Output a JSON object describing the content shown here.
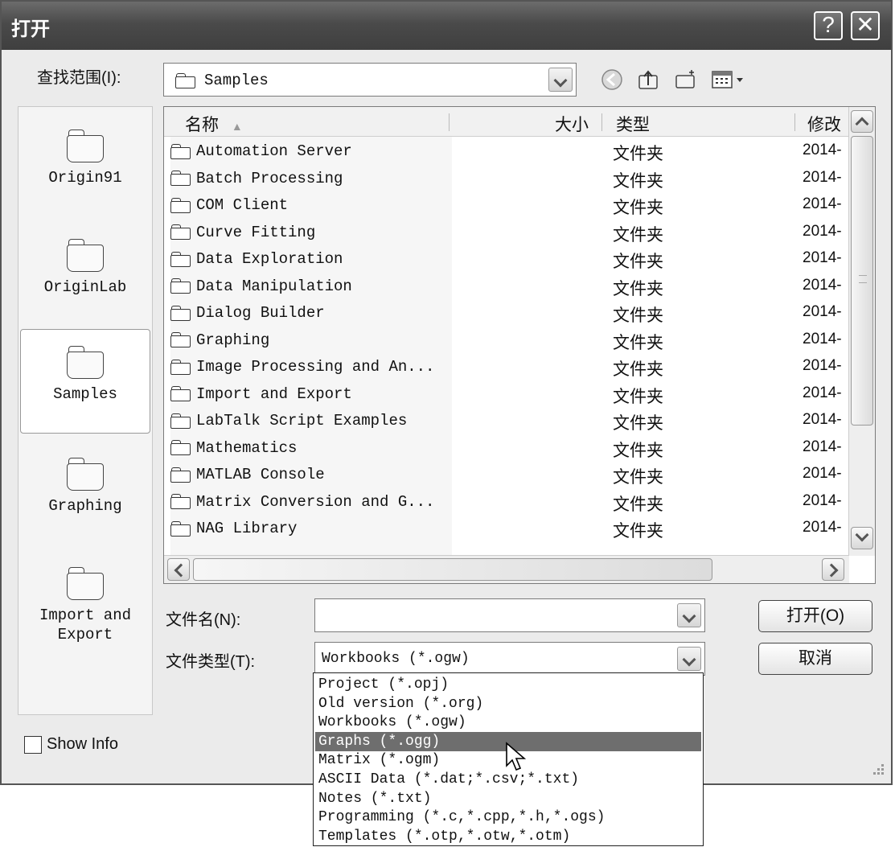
{
  "window": {
    "title": "打开",
    "help_label": "?",
    "close_label": "✕"
  },
  "lookin": {
    "label": "查找范围(I):",
    "value": "Samples"
  },
  "toolbar": {
    "back": "back-icon",
    "up": "up-folder-icon",
    "newfolder": "new-folder-icon",
    "views": "views-icon"
  },
  "places": [
    {
      "label": "Origin91"
    },
    {
      "label": "OriginLab"
    },
    {
      "label": "Samples"
    },
    {
      "label": "Graphing"
    },
    {
      "label": "Import and\nExport"
    }
  ],
  "columns": {
    "name": "名称",
    "size": "大小",
    "type": "类型",
    "modified": "修改"
  },
  "files": [
    {
      "name": "Automation Server",
      "type": "文件夹",
      "modified": "2014-"
    },
    {
      "name": "Batch Processing",
      "type": "文件夹",
      "modified": "2014-"
    },
    {
      "name": "COM Client",
      "type": "文件夹",
      "modified": "2014-"
    },
    {
      "name": "Curve Fitting",
      "type": "文件夹",
      "modified": "2014-"
    },
    {
      "name": "Data Exploration",
      "type": "文件夹",
      "modified": "2014-"
    },
    {
      "name": "Data Manipulation",
      "type": "文件夹",
      "modified": "2014-"
    },
    {
      "name": "Dialog Builder",
      "type": "文件夹",
      "modified": "2014-"
    },
    {
      "name": "Graphing",
      "type": "文件夹",
      "modified": "2014-"
    },
    {
      "name": "Image Processing and An...",
      "type": "文件夹",
      "modified": "2014-"
    },
    {
      "name": "Import and Export",
      "type": "文件夹",
      "modified": "2014-"
    },
    {
      "name": "LabTalk Script Examples",
      "type": "文件夹",
      "modified": "2014-"
    },
    {
      "name": "Mathematics",
      "type": "文件夹",
      "modified": "2014-"
    },
    {
      "name": "MATLAB Console",
      "type": "文件夹",
      "modified": "2014-"
    },
    {
      "name": "Matrix Conversion and G...",
      "type": "文件夹",
      "modified": "2014-"
    },
    {
      "name": "NAG Library",
      "type": "文件夹",
      "modified": "2014-"
    }
  ],
  "filename": {
    "label": "文件名(N):",
    "value": ""
  },
  "filetype": {
    "label": "文件类型(T):",
    "value": "Workbooks (*.ogw)",
    "options": [
      "Project (*.opj)",
      "Old version (*.org)",
      "Workbooks (*.ogw)",
      "Graphs (*.ogg)",
      "Matrix (*.ogm)",
      "ASCII Data (*.dat;*.csv;*.txt)",
      "Notes (*.txt)",
      "Programming (*.c,*.cpp,*.h,*.ogs)",
      "Templates (*.otp,*.otw,*.otm)"
    ],
    "highlighted_index": 3
  },
  "buttons": {
    "open": "打开(O)",
    "cancel": "取消"
  },
  "showinfo": {
    "label": "Show Info",
    "checked": false
  }
}
